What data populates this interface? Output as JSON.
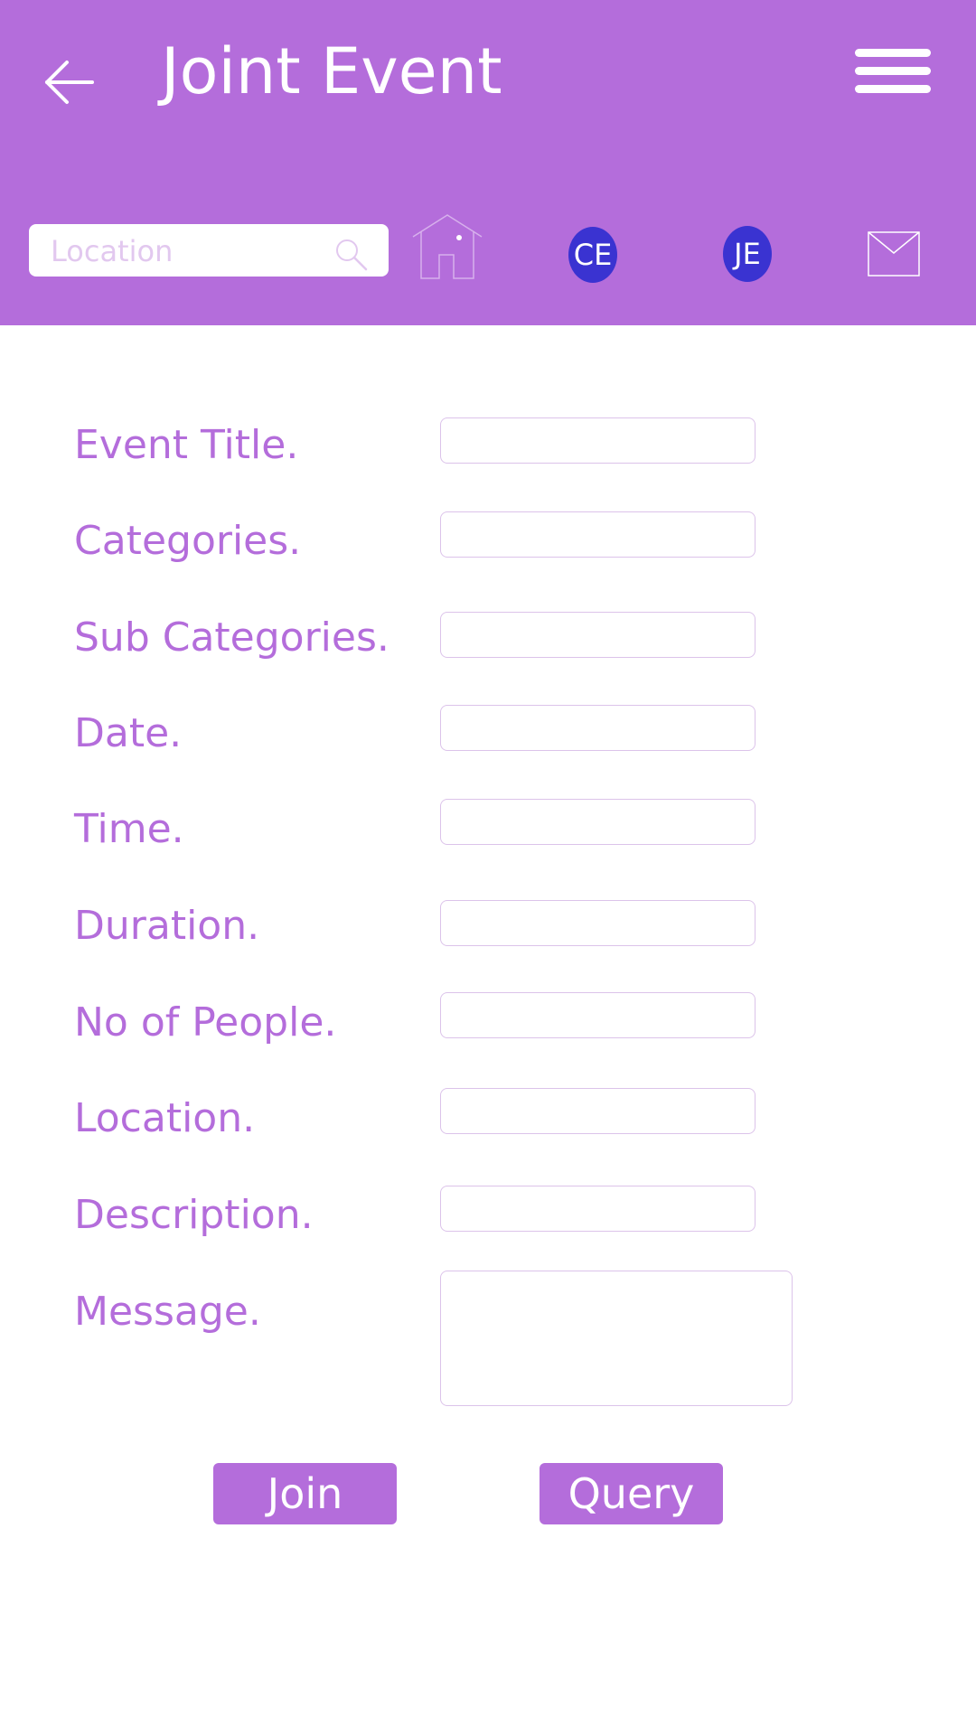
{
  "header": {
    "title": "Joint Event",
    "back_icon": "arrow-left-icon",
    "menu_icon": "hamburger-menu-icon",
    "background_color": "#b46ddb"
  },
  "toolbar": {
    "search_placeholder": "Location",
    "search_value": "",
    "search_icon": "search-icon",
    "home_icon": "home-icon",
    "avatars": [
      {
        "initials": "CE",
        "color": "#3a33d1"
      },
      {
        "initials": "JE",
        "color": "#3a33d1"
      }
    ],
    "mail_icon": "mail-icon"
  },
  "form": {
    "fields": [
      {
        "label": "Event Title.",
        "value": ""
      },
      {
        "label": "Categories.",
        "value": ""
      },
      {
        "label": "Sub Categories.",
        "value": ""
      },
      {
        "label": "Date.",
        "value": ""
      },
      {
        "label": "Time.",
        "value": ""
      },
      {
        "label": "Duration.",
        "value": ""
      },
      {
        "label": "No of People.",
        "value": ""
      },
      {
        "label": "Location.",
        "value": ""
      },
      {
        "label": "Description.",
        "value": ""
      },
      {
        "label": "Message.",
        "value": ""
      }
    ]
  },
  "actions": {
    "join_label": "Join",
    "query_label": "Query"
  },
  "colors": {
    "accent": "#b46ddb",
    "avatar": "#3a33d1",
    "input_border": "#dcc3ea"
  }
}
